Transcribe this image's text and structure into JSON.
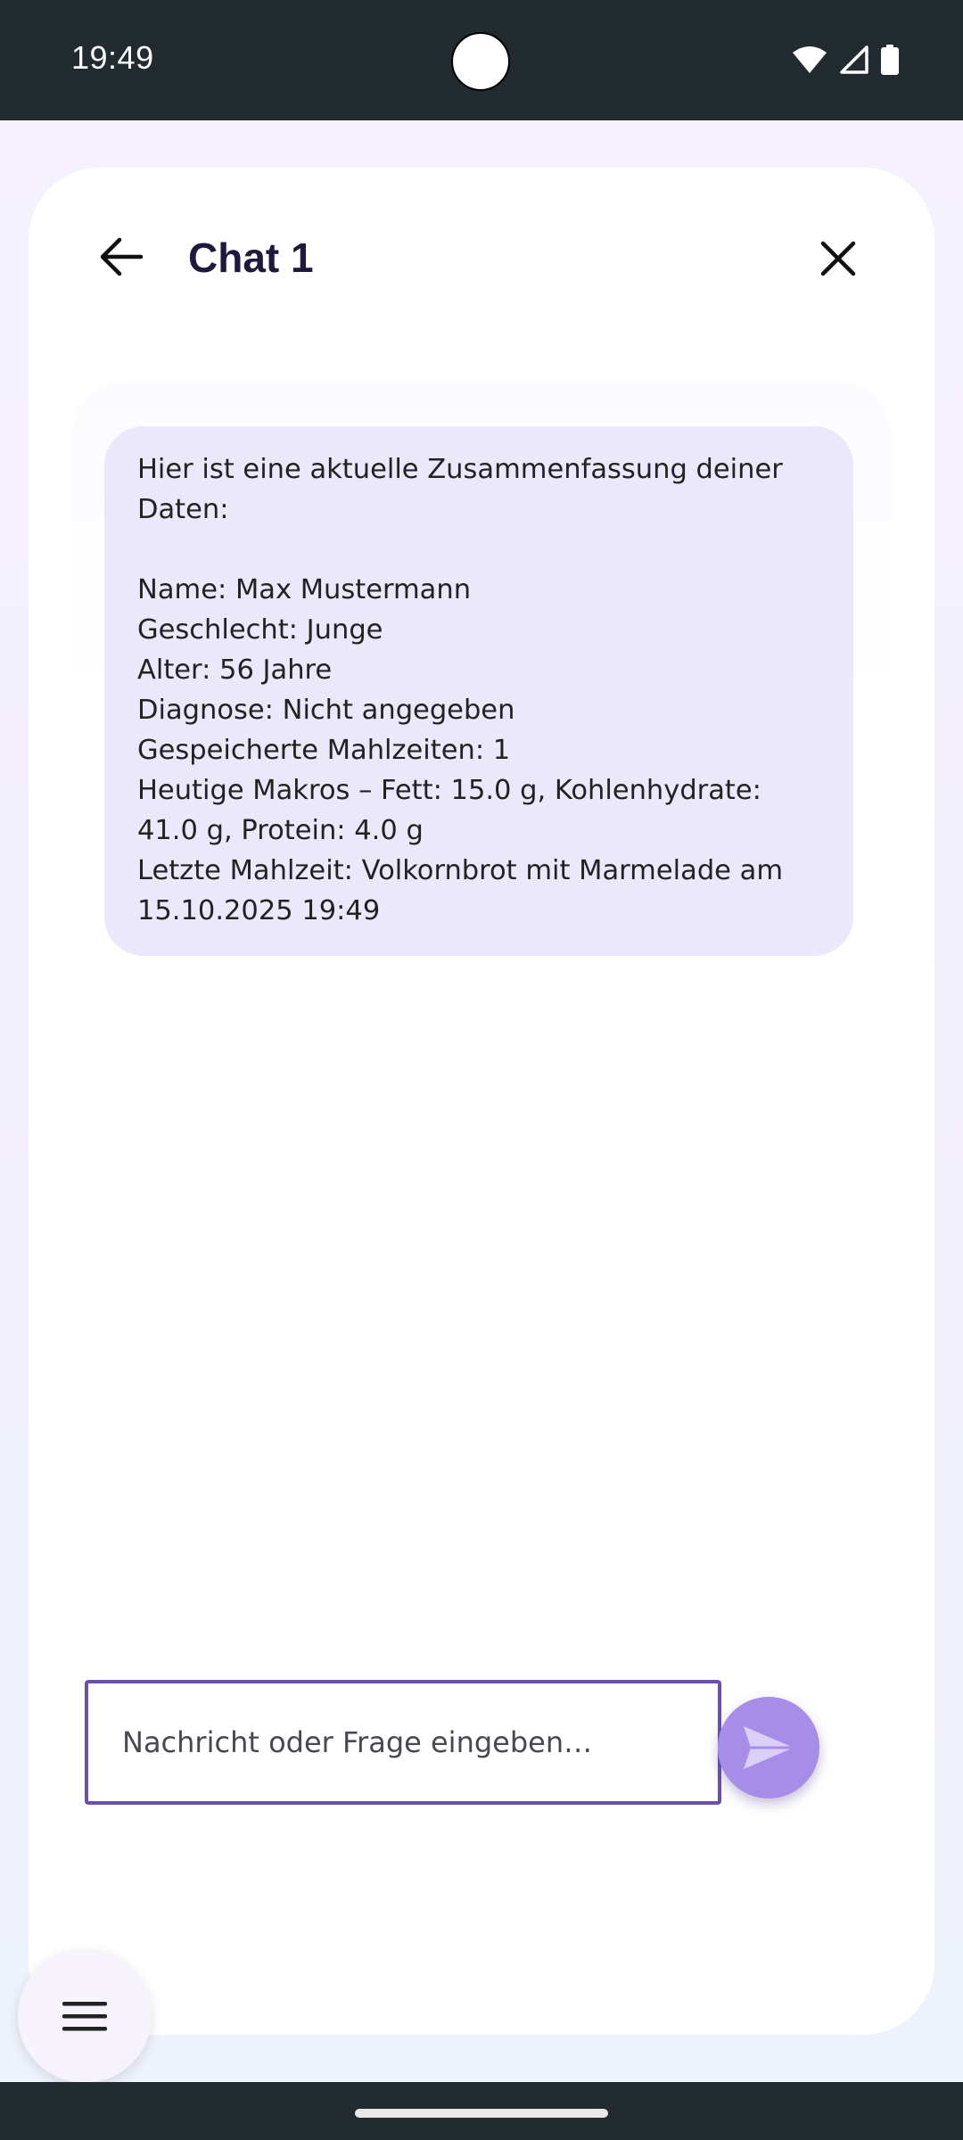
{
  "status_bar": {
    "time": "19:49",
    "icons": [
      "wifi-icon",
      "cellular-signal-icon",
      "battery-icon"
    ]
  },
  "header": {
    "title": "Chat 1",
    "back_icon": "arrow-back-icon",
    "close_icon": "close-icon"
  },
  "messages": [
    {
      "sender": "assistant",
      "text": "Hier ist eine aktuelle Zusammenfassung deiner Daten:\n\nName: Max Mustermann\nGeschlecht: Junge\nAlter: 56 Jahre\nDiagnose: Nicht angegeben\nGespeicherte Mahlzeiten: 1\nHeutige Makros – Fett: 15.0 g, Kohlenhydrate: 41.0 g, Protein: 4.0 g\nLetzte Mahlzeit: Volkornbrot mit Marmelade am 15.10.2025 19:49"
    }
  ],
  "composer": {
    "placeholder": "Nachricht oder Frage eingeben…",
    "value": "",
    "send_icon": "send-icon"
  },
  "menu_fab": {
    "icon": "menu-icon"
  },
  "colors": {
    "status_bar": "#222b30",
    "title": "#1f1a3d",
    "bubble": "#ebe8fb",
    "input_border": "#6a4fb0",
    "send_button": "#a68ee8"
  }
}
